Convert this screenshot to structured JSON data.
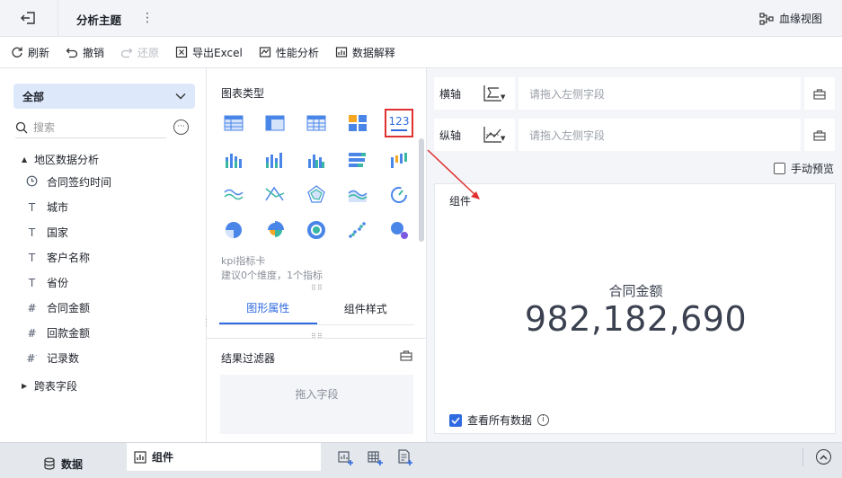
{
  "topbar": {
    "title": "分析主题",
    "lineage_label": "血缘视图"
  },
  "toolbar": {
    "refresh": "刷新",
    "undo": "撤销",
    "redo": "还原",
    "export_excel": "导出Excel",
    "performance": "性能分析",
    "data_explain": "数据解释"
  },
  "left": {
    "package_select": "全部",
    "search_placeholder": "搜索",
    "group1": "地区数据分析",
    "fields": [
      {
        "type": "date",
        "name": "合同签约时间"
      },
      {
        "type": "text",
        "name": "城市"
      },
      {
        "type": "text",
        "name": "国家"
      },
      {
        "type": "text",
        "name": "客户名称"
      },
      {
        "type": "text",
        "name": "省份"
      },
      {
        "type": "number",
        "name": "合同金额"
      },
      {
        "type": "number",
        "name": "回款金额"
      },
      {
        "type": "count",
        "name": "记录数"
      }
    ],
    "group2": "跨表字段"
  },
  "middle": {
    "chart_type_label": "图表类型",
    "selected_chart_icon_text": "123",
    "selected_chart_name": "kpi指标卡",
    "selected_chart_desc": "建议0个维度，1个指标",
    "tabs": [
      "图形属性",
      "组件样式"
    ],
    "active_tab": "图形属性",
    "filter_title": "结果过滤器",
    "filter_placeholder": "拖入字段"
  },
  "right": {
    "x_axis_label": "横轴",
    "y_axis_label": "纵轴",
    "x_axis_placeholder": "请拖入左侧字段",
    "y_axis_placeholder": "请拖入左侧字段",
    "manual_preview": "手动预览",
    "widget_title": "组件",
    "kpi_label": "合同金额",
    "kpi_value": "982,182,690",
    "view_all_data": "查看所有数据"
  },
  "bottom": {
    "data_tab": "数据",
    "widget_tab": "组件"
  },
  "colors": {
    "accent": "#2f6ae0",
    "highlight": "#e0302f",
    "select_bg": "#dde9fb"
  }
}
